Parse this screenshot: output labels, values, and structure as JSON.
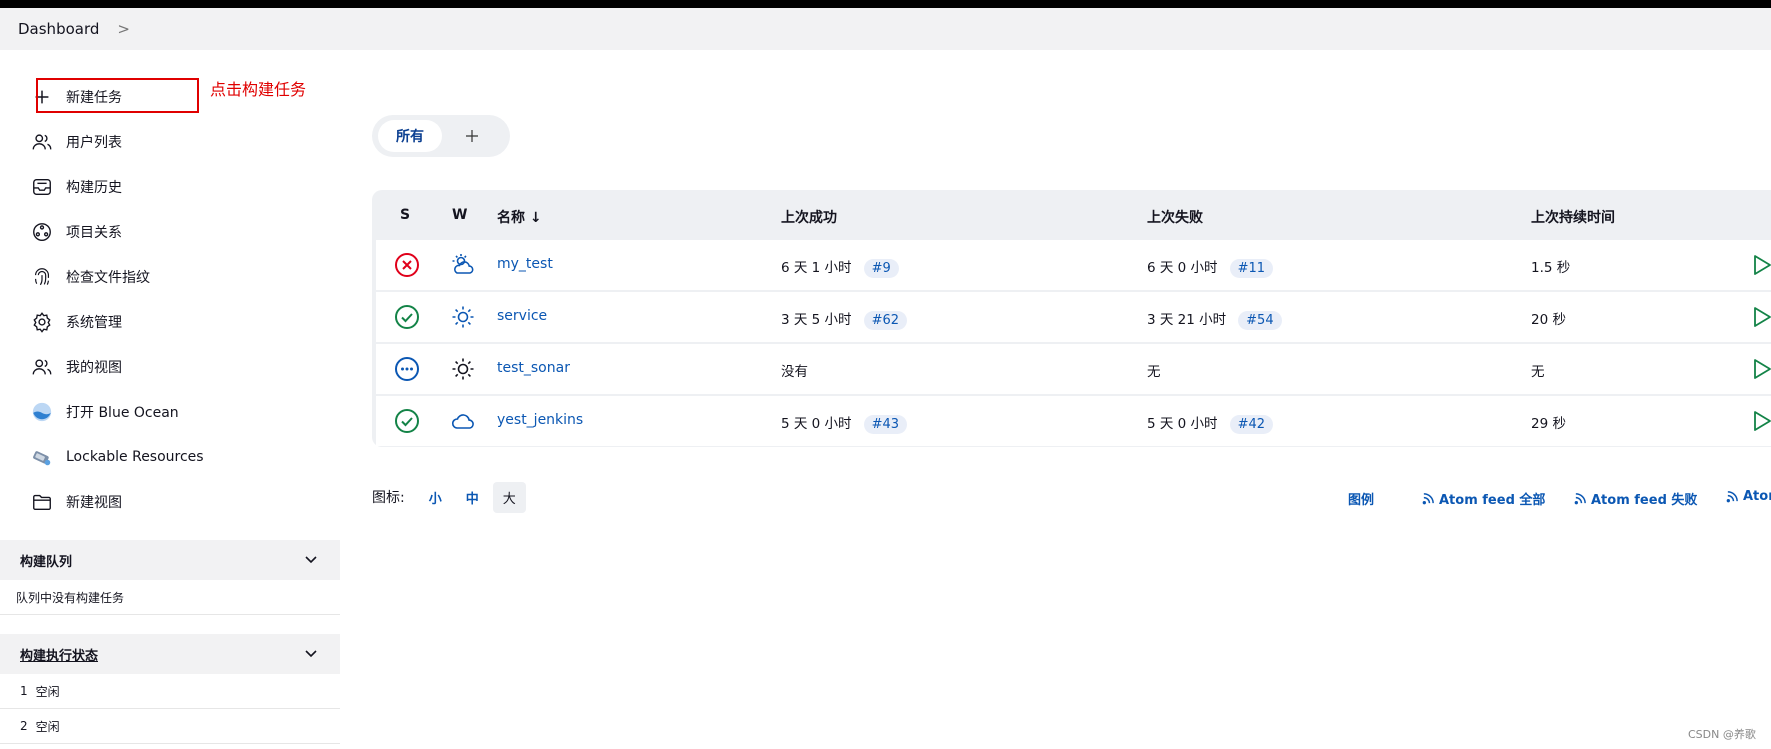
{
  "breadcrumb": {
    "root": "Dashboard",
    "separator": ">"
  },
  "annotation": "点击构建任务",
  "sidebar": {
    "items": [
      {
        "label": "新建任务",
        "icon": "plus-icon"
      },
      {
        "label": "用户列表",
        "icon": "people-icon"
      },
      {
        "label": "构建历史",
        "icon": "inbox-icon"
      },
      {
        "label": "项目关系",
        "icon": "relationship-icon"
      },
      {
        "label": "检查文件指纹",
        "icon": "fingerprint-icon"
      },
      {
        "label": "系统管理",
        "icon": "gear-icon"
      },
      {
        "label": "我的视图",
        "icon": "people-icon"
      },
      {
        "label": "打开 Blue Ocean",
        "icon": "blue-ocean-icon"
      },
      {
        "label": "Lockable Resources",
        "icon": "lock-resource-icon"
      },
      {
        "label": "新建视图",
        "icon": "folder-icon"
      }
    ]
  },
  "build_queue": {
    "title": "构建队列",
    "empty_text": "队列中没有构建任务"
  },
  "executors": {
    "title": "构建执行状态",
    "rows": [
      {
        "num": "1",
        "status": "空闲"
      },
      {
        "num": "2",
        "status": "空闲"
      }
    ]
  },
  "tabs": {
    "active": "所有",
    "add": "+"
  },
  "table": {
    "headers": {
      "s": "S",
      "w": "W",
      "name": "名称 ↓",
      "last_success": "上次成功",
      "last_failure": "上次失败",
      "last_duration": "上次持续时间"
    },
    "rows": [
      {
        "status": "failed",
        "weather": "cloudy-sun",
        "name": "my_test",
        "last_success": "6 天 1 小时",
        "success_build": "#9",
        "last_failure": "6 天 0 小时",
        "failure_build": "#11",
        "duration": "1.5 秒"
      },
      {
        "status": "success",
        "weather": "sunny",
        "name": "service",
        "last_success": "3 天 5 小时",
        "success_build": "#62",
        "last_failure": "3 天 21 小时",
        "failure_build": "#54",
        "duration": "20 秒"
      },
      {
        "status": "not-built",
        "weather": "sunny",
        "name": "test_sonar",
        "last_success": "没有",
        "success_build": "",
        "last_failure": "无",
        "failure_build": "",
        "duration": "无"
      },
      {
        "status": "success",
        "weather": "cloudy",
        "name": "yest_jenkins",
        "last_success": "5 天 0 小时",
        "success_build": "#43",
        "last_failure": "5 天 0 小时",
        "failure_build": "#42",
        "duration": "29 秒"
      }
    ]
  },
  "footer": {
    "icon_label": "图标:",
    "sizes": [
      "小",
      "中",
      "大"
    ],
    "legend": "图例",
    "atom_all": "Atom feed 全部",
    "atom_failed": "Atom feed 失败",
    "atom_latest": "Ator"
  },
  "watermark": "CSDN @养歌",
  "colors": {
    "accent": "#0b57b3",
    "success": "#138347",
    "failure": "#e0001a",
    "annotation": "#e00000"
  }
}
